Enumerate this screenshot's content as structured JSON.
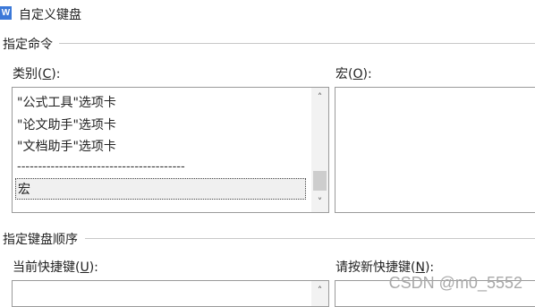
{
  "window": {
    "title": "自定义键盘",
    "icon_letter": "W"
  },
  "section_command": {
    "label": "指定命令"
  },
  "category": {
    "label_prefix": "类别(",
    "label_key": "C",
    "label_suffix": "):",
    "items": [
      "\"公式工具\"选项卡",
      "\"论文助手\"选项卡",
      "\"文档助手\"选项卡"
    ],
    "separator": "----------------------------------------",
    "selected_item": "宏"
  },
  "macro": {
    "label_prefix": "宏(",
    "label_key": "O",
    "label_suffix": "):"
  },
  "section_order": {
    "label": "指定键盘顺序"
  },
  "current_shortcut": {
    "label_prefix": "当前快捷键(",
    "label_key": "U",
    "label_suffix": "):"
  },
  "new_shortcut": {
    "label_prefix": "请按新快捷键(",
    "label_key": "N",
    "label_suffix": "):"
  },
  "watermark": "CSDN @m0_5552",
  "colors": {
    "icon_blue": "#3b78d8",
    "border": "#9a9a9a",
    "watermark": "#a9a9a9"
  }
}
